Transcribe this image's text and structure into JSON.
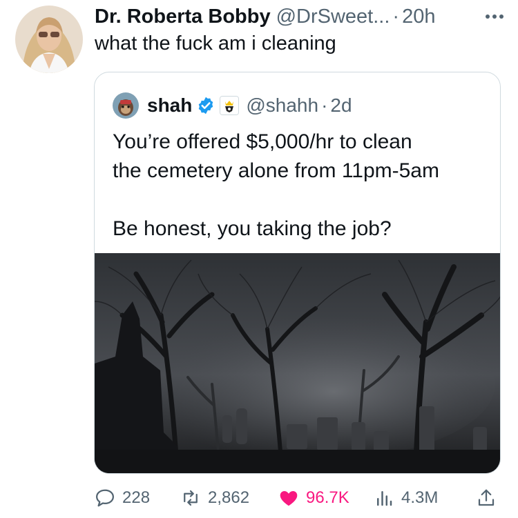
{
  "tweet": {
    "author_name": "Dr. Roberta Bobby",
    "author_handle": "@DrSweet...",
    "separator": "·",
    "time": "20h",
    "text": "what the fuck am i cleaning"
  },
  "quoted": {
    "name": "shah",
    "handle": "@shahh",
    "separator": "·",
    "time": "2d",
    "lines": [
      "You’re offered $5,000/hr to clean",
      "the cemetery alone from 11pm-5am",
      "Be honest, you taking the job?"
    ]
  },
  "actions": {
    "replies": "228",
    "retweets": "2,862",
    "likes": "96.7K",
    "views": "4.3M"
  },
  "icons": {
    "more": "more-horizontal-icon",
    "verified": "verified-badge-icon",
    "affiliate": "affiliate-badge-icon",
    "reply": "reply-icon",
    "retweet": "retweet-icon",
    "like": "heart-icon",
    "views": "views-icon",
    "share": "share-icon"
  },
  "colors": {
    "text": "#0f1419",
    "secondary": "#536471",
    "verified": "#1d9bf0",
    "like": "#f91880",
    "border": "#cfd9de"
  }
}
